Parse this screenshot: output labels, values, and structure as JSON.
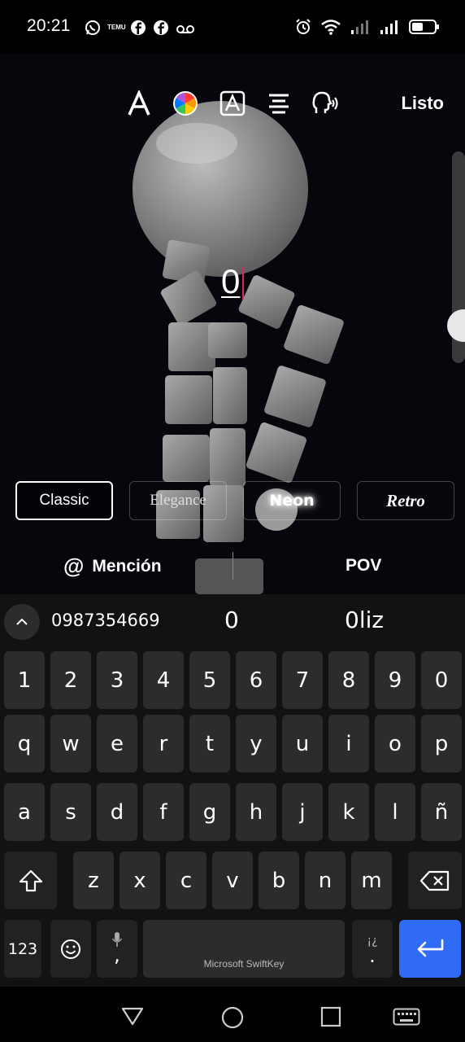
{
  "status_bar": {
    "time": "20:21",
    "temu_label": "TEMU"
  },
  "toolbar": {
    "done_label": "Listo"
  },
  "editor": {
    "typed_text": "0"
  },
  "styles": [
    {
      "label": "Classic"
    },
    {
      "label": "Elegance"
    },
    {
      "label": "Neon"
    },
    {
      "label": "Retro"
    }
  ],
  "options": {
    "mention_label": "Mención",
    "pov_label": "POV"
  },
  "suggestions": {
    "left": "0987354669",
    "middle": "0",
    "right": "0liz"
  },
  "keyboard": {
    "row_numbers": [
      "1",
      "2",
      "3",
      "4",
      "5",
      "6",
      "7",
      "8",
      "9",
      "0"
    ],
    "row1": [
      "q",
      "w",
      "e",
      "r",
      "t",
      "y",
      "u",
      "i",
      "o",
      "p"
    ],
    "row2": [
      "a",
      "s",
      "d",
      "f",
      "g",
      "h",
      "j",
      "k",
      "l",
      "ñ"
    ],
    "row3": [
      "z",
      "x",
      "c",
      "v",
      "b",
      "n",
      "m"
    ],
    "numbers_key": "123",
    "comma_key": ",",
    "period_key": ".",
    "period_alt": "¡¿",
    "space_label": "Microsoft SwiftKey"
  },
  "colors": {
    "accent_blue": "#2f6bf5",
    "caret_pink": "#e0245e"
  }
}
